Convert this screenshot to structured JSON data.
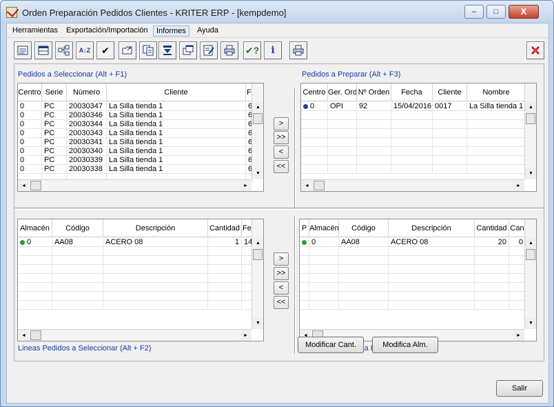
{
  "window": {
    "title": "Orden Preparación Pedidos Clientes - KRITER ERP - [kempdemo]",
    "minimize": "–",
    "maximize": "□",
    "close": "X"
  },
  "menu": [
    "Herramientas",
    "Exportación/Importación",
    "Informes",
    "Ayuda"
  ],
  "toolbar_icons": [
    "list-icon",
    "table-icon",
    "tree-icon",
    "sort-icon",
    "check-icon",
    "open-folder-icon",
    "copy-icon",
    "filter-icon",
    "windows-icon",
    "edit-icon",
    "print-icon",
    "help-check-icon",
    "info-icon",
    "printer-icon",
    "exit-icon"
  ],
  "toolbar_glyphs": [
    "",
    "",
    "",
    "A↓Z",
    "✔",
    "",
    "",
    "",
    "",
    "",
    "",
    "✔?",
    "i",
    "",
    ""
  ],
  "pedidos_seleccionar": {
    "title": "Pedidos a Seleccionar  (Alt + F1)",
    "columns": [
      "Centro",
      "Serie",
      "Número",
      "Cliente",
      "F"
    ],
    "rows": [
      [
        "0",
        "PC",
        "20030347",
        "La Silla tienda 1",
        "6"
      ],
      [
        "0",
        "PC",
        "20030346",
        "La Silla tienda 1",
        "6"
      ],
      [
        "0",
        "PC",
        "20030344",
        "La Silla tienda 1",
        "6"
      ],
      [
        "0",
        "PC",
        "20030343",
        "La Silla tienda 1",
        "6"
      ],
      [
        "0",
        "PC",
        "20030341",
        "La Silla tienda 1",
        "6"
      ],
      [
        "0",
        "PC",
        "20030340",
        "La Silla tienda 1",
        "6"
      ],
      [
        "0",
        "PC",
        "20030339",
        "La Silla tienda 1",
        "6"
      ],
      [
        "0",
        "PC",
        "20030338",
        "La Silla tienda 1",
        "6"
      ]
    ]
  },
  "pedidos_preparar": {
    "title": "Pedidos a Preparar  (Alt + F3)",
    "columns": [
      "Centro",
      "Ger. Ord",
      "Nº Orden",
      "Fecha",
      "Cliente",
      "Nombre"
    ],
    "rows": [
      [
        "0",
        "OPI",
        "92",
        "15/04/2016",
        "0017",
        "La Silla tienda 1"
      ]
    ]
  },
  "lineas_seleccionar": {
    "title": "Lineas Pedidos a Seleccionar  (Alt + F2)",
    "columns": [
      "Almacén",
      "Código",
      "Descripción",
      "Cantidad",
      "Fe"
    ],
    "rows": [
      [
        "0",
        "AA08",
        "ACERO 08",
        "1",
        "14"
      ]
    ]
  },
  "lineas_preparar": {
    "title": "Lineas de Pedidos a Preparar  (Alt + F4)",
    "columns": [
      "P",
      "Almacén",
      "Código",
      "Descripción",
      "Cantidad",
      "Can"
    ],
    "rows": [
      [
        "",
        "0",
        "AA08",
        "ACERO 08",
        "20",
        "0"
      ]
    ]
  },
  "transfer_buttons": [
    ">",
    ">>",
    "<",
    "<<"
  ],
  "scroll": {
    "up": "▲",
    "down": "▼",
    "left": "◄",
    "right": "►"
  },
  "buttons": {
    "modificar_cant": "Modificar Cant.",
    "modifica_alm": "Modifica Alm.",
    "salir": "Salir"
  },
  "colors": {
    "title_blue": "#1b3aa8",
    "dot_blue": "#1d3fa0",
    "dot_green": "#2f9a2f"
  }
}
